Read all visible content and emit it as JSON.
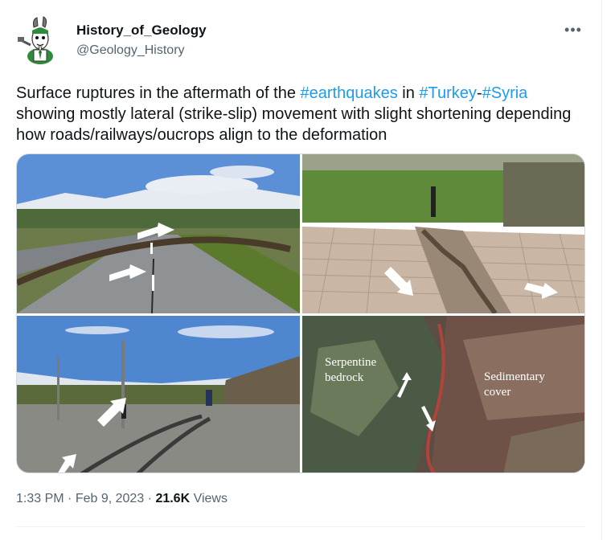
{
  "author": {
    "display_name": "History_of_Geology",
    "handle": "@Geology_History"
  },
  "more_glyph": "•••",
  "tweet": {
    "text_before": "Surface ruptures in the aftermath of the ",
    "hashtag_1": "#earthquakes",
    "text_mid_1": " in ",
    "hashtag_2": "#Turkey",
    "text_mid_2": "-",
    "hashtag_3": "#Syria",
    "text_after": " showing mostly lateral (strike-slip) movement with slight shortening depending how roads/railways/oucrops align to the deformation"
  },
  "photo_labels": {
    "serpentine_line1": "Serpentine",
    "serpentine_line2": "bedrock",
    "sedimentary_line1": "Sedimentary",
    "sedimentary_line2": "cover"
  },
  "meta": {
    "time": "1:33 PM",
    "separator": " · ",
    "date": "Feb 9, 2023",
    "views_count": "21.6K",
    "views_label": " Views"
  },
  "colors": {
    "accent": "#1d9bf0",
    "secondary_text": "#536471",
    "primary_text": "#0f1419"
  }
}
